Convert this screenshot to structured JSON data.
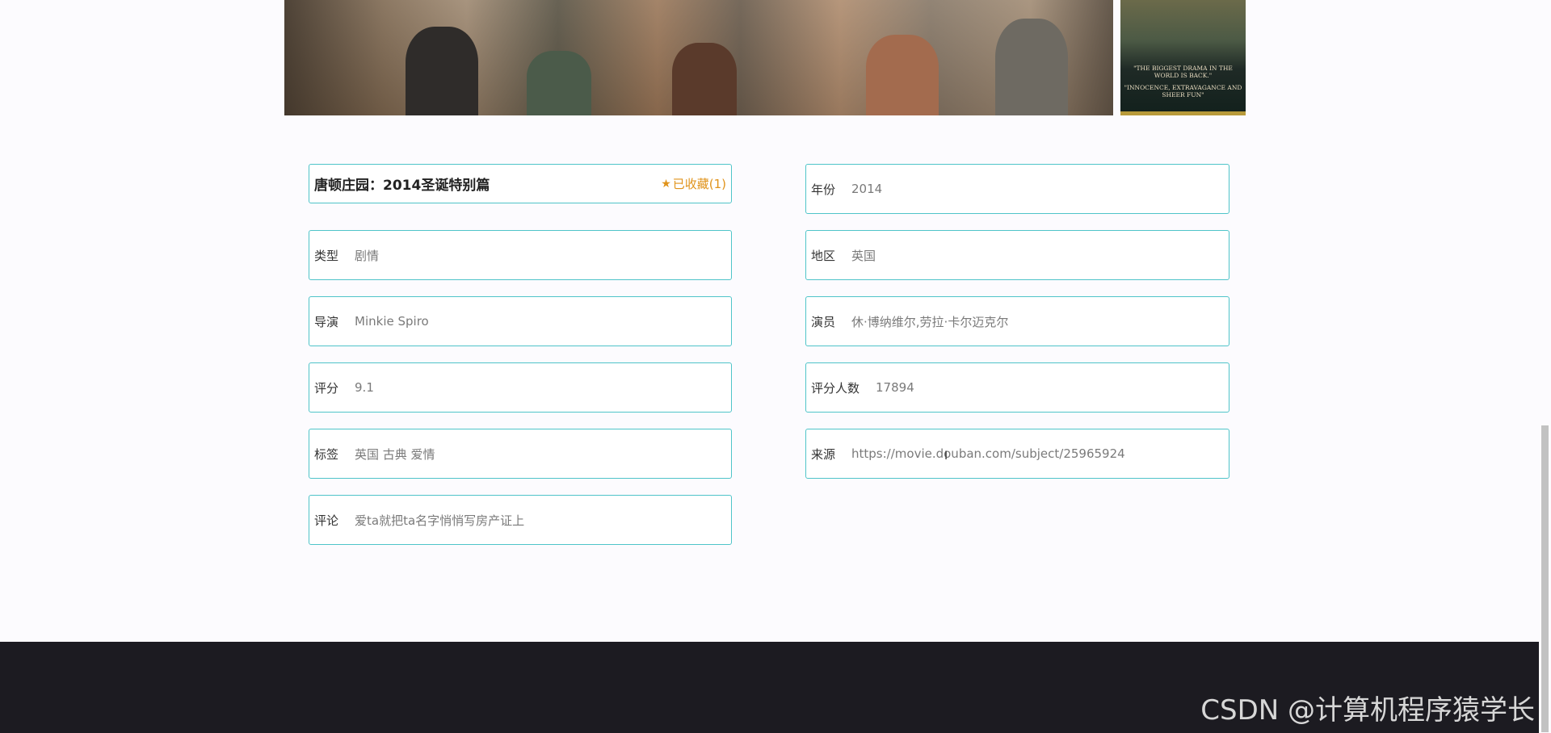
{
  "movie": {
    "title": "唐顿庄园：2014圣诞特别篇",
    "favorite_label": "已收藏(1)",
    "favorite_icon": "star-icon",
    "accent_color": "#4fc4c9",
    "favorite_color": "#e0931b"
  },
  "poster": {
    "quote1": "\"THE BIGGEST DRAMA IN THE WORLD IS BACK.\"",
    "quote2": "\"INNOCENCE, EXTRAVAGANCE AND SHEER FUN\""
  },
  "fields": {
    "year": {
      "label": "年份",
      "value": "2014"
    },
    "genre": {
      "label": "类型",
      "value": "剧情"
    },
    "region": {
      "label": "地区",
      "value": "英国"
    },
    "director": {
      "label": "导演",
      "value": "Minkie Spiro"
    },
    "actors": {
      "label": "演员",
      "value": "休·博纳维尔,劳拉·卡尔迈克尔"
    },
    "rating": {
      "label": "评分",
      "value": "9.1"
    },
    "rating_count": {
      "label": "评分人数",
      "value": "17894"
    },
    "tags": {
      "label": "标签",
      "value": "英国 古典 爱情"
    },
    "source": {
      "label": "来源",
      "value": "https://movie.douban.com/subject/25965924"
    },
    "comment": {
      "label": "评论",
      "value": "爱ta就把ta名字悄悄写房产证上"
    }
  },
  "footer": {
    "watermark": "CSDN @计算机程序猿学长"
  }
}
